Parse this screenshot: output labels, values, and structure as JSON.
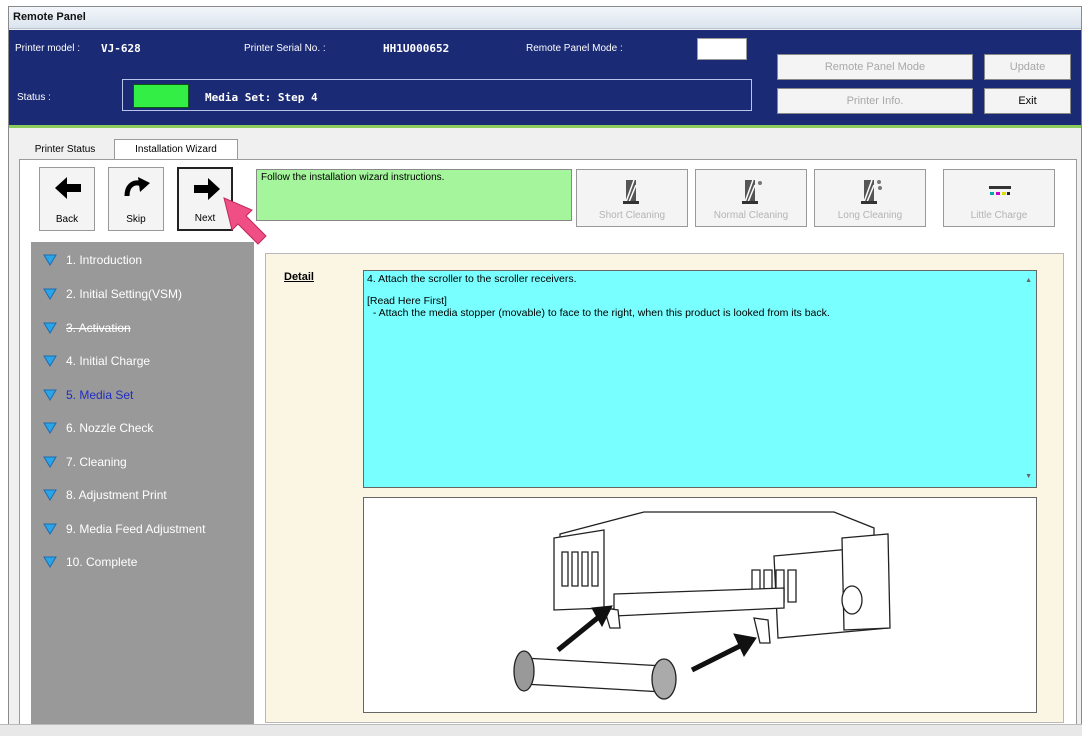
{
  "window": {
    "title": "Remote Panel"
  },
  "header": {
    "printer_model_label": "Printer model :",
    "printer_model_value": "VJ-628",
    "serial_label": "Printer Serial No. :",
    "serial_value": "HH1U000652",
    "mode_label": "Remote Panel Mode :",
    "status_label": "Status :",
    "status_text": "Media Set: Step 4",
    "status_color": "#33ee44",
    "buttons": {
      "remote_panel_mode": "Remote Panel Mode",
      "update": "Update",
      "printer_info": "Printer Info.",
      "exit": "Exit"
    }
  },
  "tabs": {
    "printer_status": "Printer Status",
    "installation_wizard": "Installation Wizard"
  },
  "nav": {
    "back": "Back",
    "skip": "Skip",
    "next": "Next"
  },
  "instruction": "Follow the installation wizard instructions.",
  "cleaning": {
    "short": "Short Cleaning",
    "normal": "Normal Cleaning",
    "long": "Long Cleaning",
    "little_charge": "Little Charge"
  },
  "steps": [
    {
      "label": "1. Introduction",
      "state": "normal"
    },
    {
      "label": "2. Initial Setting(VSM)",
      "state": "normal"
    },
    {
      "label": "3. Activation",
      "state": "struck"
    },
    {
      "label": "4. Initial Charge",
      "state": "normal"
    },
    {
      "label": "5. Media Set",
      "state": "current"
    },
    {
      "label": "6. Nozzle Check",
      "state": "normal"
    },
    {
      "label": "7. Cleaning",
      "state": "normal"
    },
    {
      "label": "8. Adjustment Print",
      "state": "normal"
    },
    {
      "label": "9. Media Feed Adjustment",
      "state": "normal"
    },
    {
      "label": "10. Complete",
      "state": "normal"
    }
  ],
  "detail": {
    "label": "Detail",
    "line1": "4. Attach the scroller to the scroller receivers.",
    "line2": "[Read Here First]",
    "line3": "  - Attach the media stopper (movable) to face to the right, when this product is looked from its back."
  },
  "colors": {
    "header_bg": "#1a2a75",
    "instruction_bg": "#a4f59c",
    "detail_bg": "#78ffff",
    "current_step": "#1f2dbe",
    "pointer": "#ef4f84"
  }
}
